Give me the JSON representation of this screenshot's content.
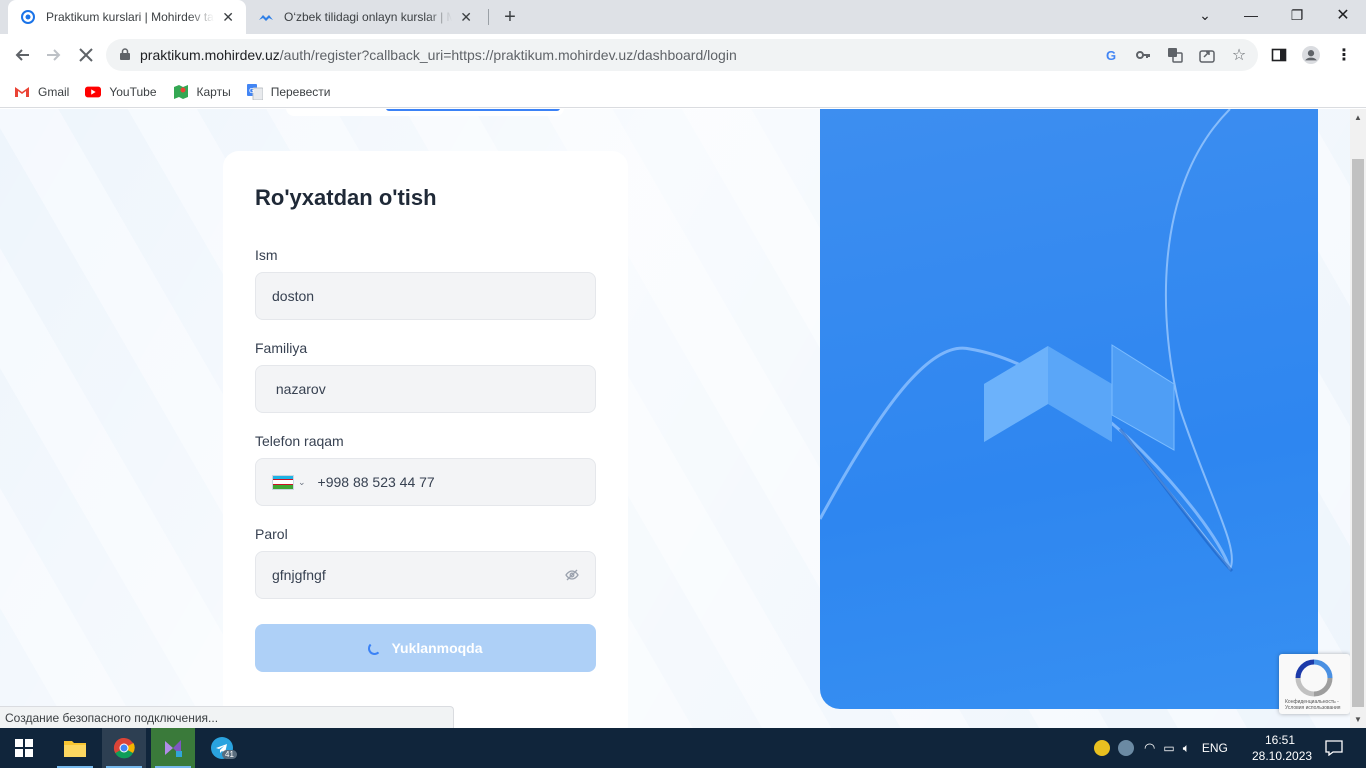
{
  "browser": {
    "tabs": [
      {
        "title": "Praktikum kurslari | Mohirdev ta",
        "active": true
      },
      {
        "title": "O‘zbek tilidagi onlayn kurslar | M",
        "active": false
      }
    ],
    "url_host": "praktikum.mohirdev.uz",
    "url_path": "/auth/register?callback_uri=https://praktikum.mohirdev.uz/dashboard/login",
    "bookmarks": [
      {
        "label": "Gmail",
        "icon": "gmail-icon"
      },
      {
        "label": "YouTube",
        "icon": "youtube-icon"
      },
      {
        "label": "Карты",
        "icon": "maps-icon"
      },
      {
        "label": "Перевести",
        "icon": "translate-icon"
      }
    ],
    "status_text": "Создание безопасного подключения..."
  },
  "form": {
    "title": "Ro'yxatdan o'tish",
    "first_name_label": "Ism",
    "first_name_value": "doston",
    "last_name_label": "Familiya",
    "last_name_value": " nazarov",
    "phone_label": "Telefon raqam",
    "phone_value": "+998 88 523 44 77",
    "password_label": "Parol",
    "password_value": "gfnjgfngf",
    "submit_label": "Yuklanmoqda"
  },
  "recaptcha": {
    "text": "Конфиденциальность - Условия использования"
  },
  "taskbar": {
    "time": "16:51",
    "date": "28.10.2023",
    "lang": "ENG",
    "telegram_badge": "41"
  },
  "colors": {
    "accent": "#3b82f6",
    "hero": "#2e86f0",
    "button_loading": "#aed0f7"
  }
}
